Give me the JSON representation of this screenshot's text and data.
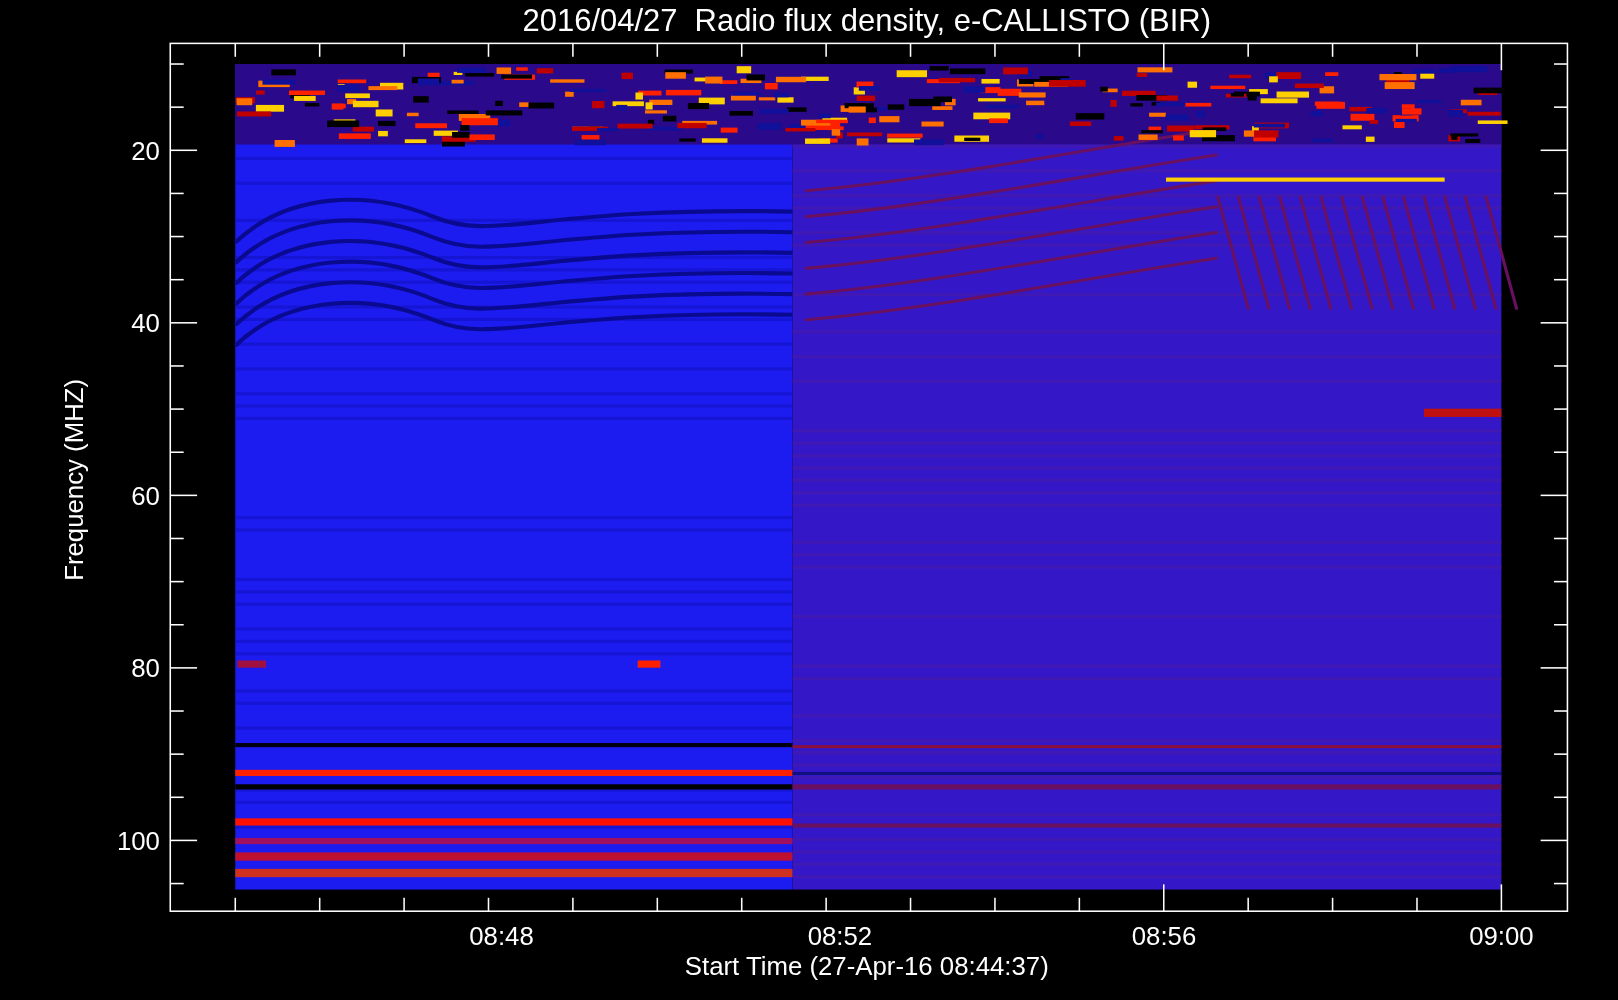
{
  "title": "2016/04/27  Radio flux density, e-CALLISTO (BIR)",
  "y_axis": {
    "label": "Frequency (MHZ)",
    "ticks": [
      "20",
      "40",
      "60",
      "80",
      "100"
    ]
  },
  "x_axis": {
    "label": "Start Time (27-Apr-16 08:44:37)",
    "ticks": [
      "08:48",
      "08:52",
      "08:56",
      "09:00"
    ]
  }
}
